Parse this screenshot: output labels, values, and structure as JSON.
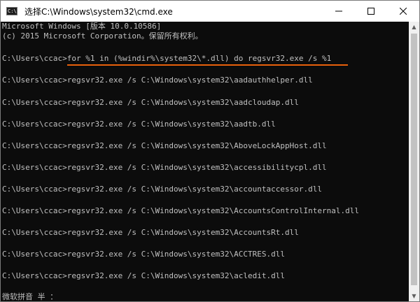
{
  "window": {
    "title": "选择C:\\Windows\\system32\\cmd.exe",
    "icon": "cmd-icon",
    "icon_text": "C:\\"
  },
  "controls": {
    "minimize": "minimize-icon",
    "maximize": "maximize-icon",
    "close": "close-icon"
  },
  "console": {
    "header_lines": [
      "Microsoft Windows [版本 10.0.10586]",
      "(c) 2015 Microsoft Corporation。保留所有权利。"
    ],
    "prompt": "C:\\Users\\ccac>",
    "command": "for %1 in (%windir%\\system32\\*.dll) do regsvr32.exe /s %1",
    "output_lines": [
      "C:\\Users\\ccac>regsvr32.exe /s C:\\Windows\\system32\\aadauthhelper.dll",
      "C:\\Users\\ccac>regsvr32.exe /s C:\\Windows\\system32\\aadcloudap.dll",
      "C:\\Users\\ccac>regsvr32.exe /s C:\\Windows\\system32\\aadtb.dll",
      "C:\\Users\\ccac>regsvr32.exe /s C:\\Windows\\system32\\AboveLockAppHost.dll",
      "C:\\Users\\ccac>regsvr32.exe /s C:\\Windows\\system32\\accessibilitycpl.dll",
      "C:\\Users\\ccac>regsvr32.exe /s C:\\Windows\\system32\\accountaccessor.dll",
      "C:\\Users\\ccac>regsvr32.exe /s C:\\Windows\\system32\\AccountsControlInternal.dll",
      "C:\\Users\\ccac>regsvr32.exe /s C:\\Windows\\system32\\AccountsRt.dll",
      "C:\\Users\\ccac>regsvr32.exe /s C:\\Windows\\system32\\ACCTRES.dll",
      "C:\\Users\\ccac>regsvr32.exe /s C:\\Windows\\system32\\acledit.dll"
    ],
    "ime_status": "微软拼音 半 ："
  },
  "scrollbar": {
    "up_icon": "scroll-up-arrow-icon",
    "down_icon": "scroll-down-arrow-icon"
  },
  "colors": {
    "console_bg": "#0c0c0c",
    "console_text": "#c0c0c0",
    "highlight": "#e8600b",
    "titlebar_bg": "#ffffff"
  }
}
